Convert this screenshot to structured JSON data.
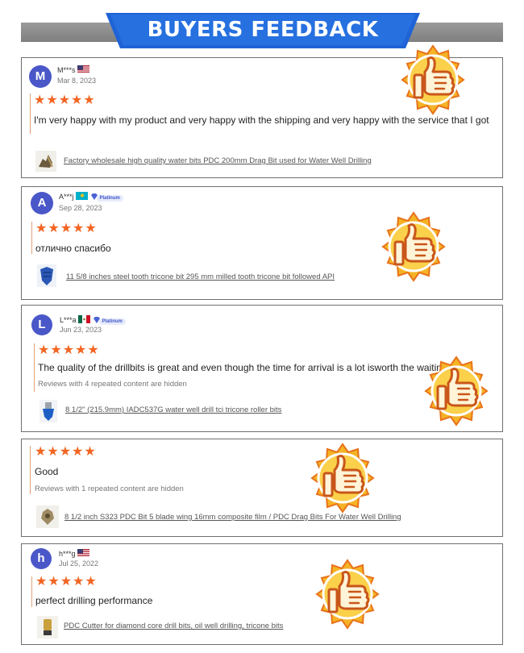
{
  "header": {
    "title": "BUYERS FEEDBACK"
  },
  "colors": {
    "star": "#f26522",
    "avatar": "#4a57c8",
    "banner_blue": "#1f63d6",
    "banner_gray": "#8c8c8c",
    "badge_gold": "#f5b325",
    "badge_orange": "#e8731a"
  },
  "reviews": [
    {
      "avatar_letter": "M",
      "name": "M***s",
      "flag": "us-flag-icon",
      "platinum": false,
      "date": "Mar 8, 2023",
      "stars": "★★★★★",
      "text": "I'm very happy with my product and very happy with the shipping and very happy with the service that I got",
      "hidden_note": "",
      "product": "Factory wholesale high quality water bits PDC 200mm Drag Bit used for Water Well Drilling"
    },
    {
      "avatar_letter": "A",
      "name": "A***j",
      "flag": "kz-flag-icon",
      "platinum": true,
      "platinum_label": "Platinum",
      "date": "Sep 28, 2023",
      "stars": "★★★★★",
      "text": "отлично спасибо",
      "hidden_note": "",
      "product": "11 5/8 inches steel tooth tricone bit 295 mm milled tooth tricone bit followed API"
    },
    {
      "avatar_letter": "L",
      "name": "L***a",
      "flag": "mx-flag-icon",
      "platinum": true,
      "platinum_label": "Platinum",
      "date": "Jun 23, 2023",
      "stars": "★★★★★",
      "text": "The quality of the drillbits is great and even though the time for arrival is a lot isworth the waiting.",
      "hidden_note": "Reviews with 4 repeated content are hidden",
      "product": "8 1/2\" (215.9mm) IADC537G water well drill tci tricone roller bits"
    },
    {
      "avatar_letter": "",
      "name": "",
      "flag": "",
      "platinum": false,
      "date": "",
      "stars": "★★★★★",
      "text": "Good",
      "hidden_note": "Reviews with 1 repeated content are hidden",
      "product": "8 1/2 inch S323 PDC Bit 5 blade wing 16mm composite film / PDC Drag Bits For Water Well Drilling"
    },
    {
      "avatar_letter": "h",
      "name": "h***g",
      "flag": "us-flag-icon",
      "platinum": false,
      "date": "Jul 25, 2022",
      "stars": "★★★★★",
      "text": "perfect drilling performance",
      "hidden_note": "",
      "product": "PDC Cutter for diamond core drill bits, oil well drilling, tricone bits"
    }
  ]
}
